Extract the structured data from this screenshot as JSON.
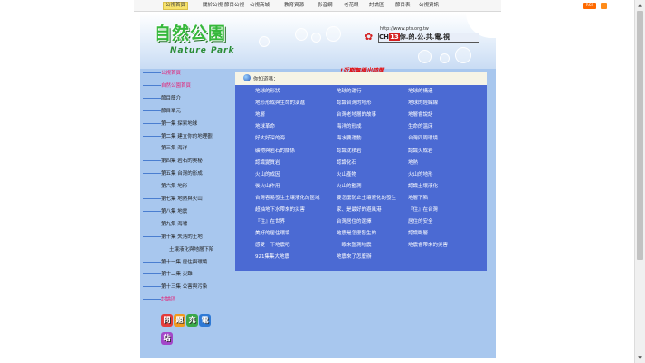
{
  "topnav": {
    "items": [
      "公視首頁",
      "關於公視",
      "節目公視",
      "公視商城",
      "教育資源",
      "影音網",
      "老花眼",
      "討論區",
      "節目表",
      "公視資訊"
    ],
    "rss_label": "RSS"
  },
  "header": {
    "logo_zh": "自然公園",
    "logo_en": "Nature Park",
    "channel_url": "http://www.pts.org.tw",
    "channel_label": "CH",
    "channel_number": "13",
    "channel_slogan": "你.的.公.共.電.視",
    "notice": "!近期無播出時間"
  },
  "sidebar": {
    "items": [
      {
        "label": "公視首頁",
        "pink": true
      },
      {
        "label": "自然公園首頁",
        "pink": true
      },
      {
        "label": "節目簡介",
        "pink": false
      },
      {
        "label": "節目單元",
        "pink": false
      },
      {
        "label": "第一集 探索地球",
        "pink": false
      },
      {
        "label": "第二集 建立你的地理觀",
        "pink": false
      },
      {
        "label": "第三集 海洋",
        "pink": false
      },
      {
        "label": "第四集 岩石的奧秘",
        "pink": false
      },
      {
        "label": "第五集 台灣的形成",
        "pink": false
      },
      {
        "label": "第六集 地形",
        "pink": false
      },
      {
        "label": "第七集 地熱與火山",
        "pink": false
      },
      {
        "label": "第八集 地震",
        "pink": false
      },
      {
        "label": "第九集 海嘯",
        "pink": false
      },
      {
        "label": "第十集 失落的土地",
        "pink": false
      },
      {
        "label": "土壤液化與地層下陷",
        "pink": false
      },
      {
        "label": "第十一集 居住與環境",
        "pink": false
      },
      {
        "label": "第十二集 災難",
        "pink": false
      },
      {
        "label": "第十三集 公害與污染",
        "pink": false
      },
      {
        "label": "討論區",
        "pink": true
      }
    ],
    "quiz_chars": [
      "問",
      "題",
      "充",
      "電",
      "站"
    ]
  },
  "content": {
    "head_label": "你知道嗎：",
    "columns": [
      [
        "地球的形狀",
        "地形形成與生命的演進",
        "地層",
        "地球革命",
        "好大好深的海",
        "礦物與岩石的關係",
        "認識變質岩",
        "火山的成因",
        "後火山作用",
        "台灣容易發生土壤液化的區域",
        "超抽地下水帶來的災害",
        "『住』在世界",
        "美好的居住環境",
        "感受一下地震吧",
        "921集集大地震"
      ],
      [
        "地球的運行",
        "認識台灣的地形",
        "台灣老地層的故事",
        "海洋的形成",
        "海水要運動",
        "認識沈積岩",
        "認識化石",
        "火山產物",
        "火山的監測",
        "要怎麼防止土壤液化的發生",
        "家、是最好的避風港",
        "台灣居住的選擇",
        "地震是怎麼發生的",
        "一眼來監測地震",
        "地震來了怎麼辦"
      ],
      [
        "地球的構造",
        "地球的經緯線",
        "地層會說話",
        "生命的溫床",
        "台灣四周環境",
        "認識火成岩",
        "地熱",
        "火山的地形",
        "認識土壤液化",
        "地層下陷",
        "『住』在台灣",
        "居住的安全",
        "認識斷層",
        "地震會帶來的災害",
        ""
      ]
    ]
  },
  "colors": {
    "panel": "#a8c7ee",
    "content_bg": "#4b6ad3",
    "notice": "#e60000",
    "pink": "#e2267a"
  }
}
